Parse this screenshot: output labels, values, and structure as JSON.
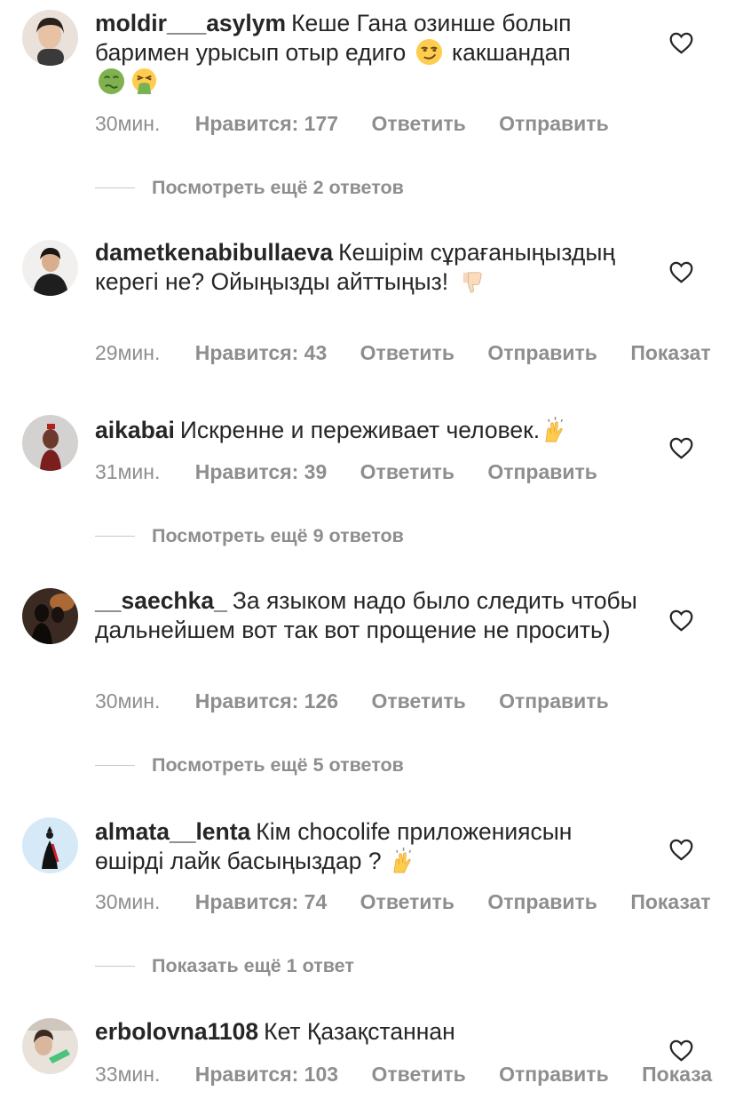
{
  "comments": [
    {
      "username": "moldir___asylym",
      "text_a": "Кеше Гана озинше болып баримен урысып отыр едиго",
      "text_b": "какшандап",
      "emoji_1": "smirk-emoji",
      "emoji_2": "nauseated-emoji",
      "emoji_3": "vomiting-emoji",
      "time": "30мин.",
      "likes": "Нравится: 177",
      "reply": "Ответить",
      "send": "Отправить",
      "view_replies": "Посмотреть ещё 2 ответов"
    },
    {
      "username": "dametkenabibullaeva",
      "text_a": "Кешірім сұрағаныңыздың керегі не? Ойыңызды айттыңыз!",
      "emoji_1": "thumbs-down-emoji",
      "time": "29мин.",
      "likes": "Нравится: 43",
      "reply": "Ответить",
      "send": "Отправить",
      "show": "Показат"
    },
    {
      "username": "aikabai",
      "text_a": "Искренне и переживает человек.",
      "emoji_1": "raising-hands-emoji",
      "time": "31мин.",
      "likes": "Нравится: 39",
      "reply": "Ответить",
      "send": "Отправить",
      "view_replies": "Посмотреть ещё 9 ответов"
    },
    {
      "username": "__saechka_",
      "text_a": "За языком надо было следить чтобы дальнейшем вот так вот прощение не просить)",
      "time": "30мин.",
      "likes": "Нравится: 126",
      "reply": "Ответить",
      "send": "Отправить",
      "view_replies": "Посмотреть ещё 5 ответов"
    },
    {
      "username": "almata__lenta",
      "text_a": "Кім chocolife приложениясын өшірді лайк басыңыздар ?",
      "emoji_1": "raising-hands-emoji",
      "time": "30мин.",
      "likes": "Нравится: 74",
      "reply": "Ответить",
      "send": "Отправить",
      "show": "Показат",
      "view_replies": "Показать ещё 1 ответ"
    },
    {
      "username": "erbolovna1108",
      "text_a": "Кет Қазақстаннан",
      "time": "33мин.",
      "likes": "Нравится: 103",
      "reply": "Ответить",
      "send": "Отправить",
      "show": "Показа"
    }
  ],
  "colors": {
    "text": "#262626",
    "secondary": "#8e8e8e",
    "divider": "#c7c7c7"
  },
  "icons": {
    "like": "heart-outline-icon"
  }
}
